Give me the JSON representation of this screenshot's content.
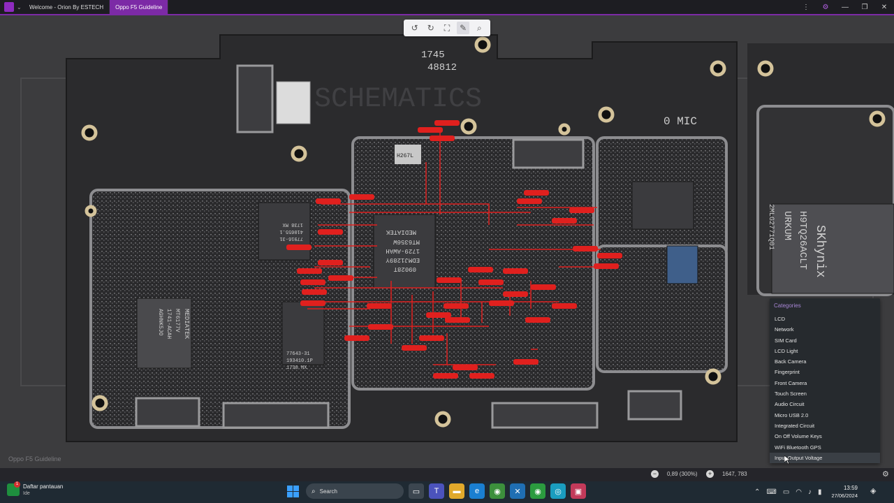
{
  "titlebar": {
    "tabs": [
      {
        "label": "Welcome - Orion By ESTECH",
        "active": false
      },
      {
        "label": "Oppo F5 Guideline",
        "active": true
      }
    ],
    "controls": {
      "more": "⋮",
      "settings": "⚙",
      "minimize": "—",
      "maximize": "❐",
      "close": "✕"
    },
    "accent_color": "#7c2aa6"
  },
  "toolbar": {
    "tools": [
      {
        "icon": "rotate-left-icon",
        "glyph": "↺"
      },
      {
        "icon": "rotate-right-icon",
        "glyph": "↻"
      },
      {
        "icon": "fit-screen-icon",
        "glyph": "⛶"
      },
      {
        "icon": "pen-tool-icon",
        "glyph": "✎"
      },
      {
        "icon": "zoom-search-icon",
        "glyph": "⌕"
      }
    ]
  },
  "canvas": {
    "caption": "Oppo F5 Guideline",
    "board_labels": {
      "cpu_brand": "MEDIATEK",
      "cpu_model": "MT6356W",
      "cpu_batch": "1729-AWAH",
      "cpu_lot": "EDMJ1289Y",
      "cpu_code": "09028T",
      "pmic_brand": "MEDIATEK",
      "pmic_model": "MT6177V",
      "pmic_batch": "1741-ACAH",
      "pmic_lot": "AGHNK5JO",
      "pa1_line1": "77916-31",
      "pa1_line2": "410655.1",
      "pa1_line3": "1738  MX",
      "pa2_line1": "77643-31",
      "pa2_line2": "193410.1P",
      "pa2_line3": "1730  MX",
      "chip_h267": "H267L",
      "mem_brand": "SKhynix",
      "mem_model": "H9TQ26ACLT",
      "mem_code": "URKUM",
      "mem_lot": "2MLG2771Q01",
      "board_id1": "1745",
      "board_id2": "48812",
      "mic_label": "0 MIC",
      "watermark": "SCHEMATICS"
    },
    "trace_color": "#e0201e"
  },
  "categories": {
    "title": "Categories",
    "items": [
      "LCD",
      "Network",
      "SIM Card",
      "LCD Light",
      "Back Camera",
      "Fingerprint",
      "Front Camera",
      "Touch Screen",
      "Audio Circuit",
      "Micro USB 2.0",
      "Integrated Circuit",
      "On Off Volume Keys",
      "WiFi Bluetooth GPS",
      "Input Output Voltage"
    ],
    "selected": "Input Output Voltage",
    "title_color": "#a886d6"
  },
  "statusbar": {
    "zoom_text": "0,89 (300%)",
    "coords": "1647, 783"
  },
  "taskbar": {
    "watchlist_title": "Daftar pantauan",
    "watchlist_sub": "Ide",
    "watchlist_badge": "1",
    "search_placeholder": "Search",
    "time": "13:59",
    "date": "27/06/2024"
  }
}
